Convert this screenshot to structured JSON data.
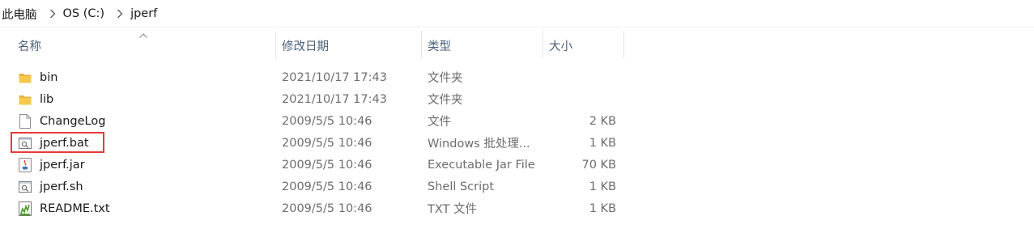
{
  "breadcrumb": {
    "items": [
      "此电脑",
      "OS (C:)",
      "jperf"
    ]
  },
  "columns": {
    "name": "名称",
    "date": "修改日期",
    "type": "类型",
    "size": "大小"
  },
  "files": [
    {
      "name": "bin",
      "date": "2021/10/17 17:43",
      "type": "文件夹",
      "size": "",
      "icon": "folder-icon"
    },
    {
      "name": "lib",
      "date": "2021/10/17 17:43",
      "type": "文件夹",
      "size": "",
      "icon": "folder-icon"
    },
    {
      "name": "ChangeLog",
      "date": "2009/5/5 10:46",
      "type": "文件",
      "size": "2 KB",
      "icon": "file-icon"
    },
    {
      "name": "jperf.bat",
      "date": "2009/5/5 10:46",
      "type": "Windows 批处理...",
      "size": "1 KB",
      "icon": "batch-file-icon"
    },
    {
      "name": "jperf.jar",
      "date": "2009/5/5 10:46",
      "type": "Executable Jar File",
      "size": "70 KB",
      "icon": "java-jar-icon"
    },
    {
      "name": "jperf.sh",
      "date": "2009/5/5 10:46",
      "type": "Shell Script",
      "size": "1 KB",
      "icon": "shell-script-icon"
    },
    {
      "name": "README.txt",
      "date": "2009/5/5 10:46",
      "type": "TXT 文件",
      "size": "1 KB",
      "icon": "text-file-icon"
    }
  ],
  "colors": {
    "folder": "#e8b33b",
    "highlight_border": "#e63a3a",
    "header_text": "#4c607a"
  }
}
